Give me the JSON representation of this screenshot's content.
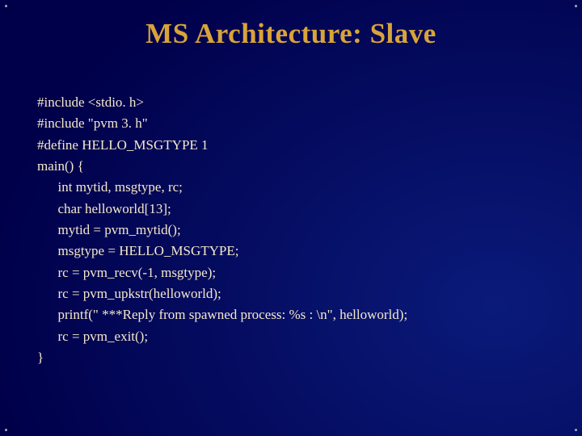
{
  "title": "MS Architecture: Slave",
  "code": {
    "l1": "#include <stdio. h>",
    "l2": "#include \"pvm 3. h\"",
    "l3": "#define HELLO_MSGTYPE 1",
    "l4": "main() {",
    "l5": "      int mytid, msgtype, rc;",
    "l6": "      char helloworld[13];",
    "l7": "      mytid = pvm_mytid();",
    "l8": "      msgtype = HELLO_MSGTYPE;",
    "l9": "      rc = pvm_recv(-1, msgtype);",
    "l10": "      rc = pvm_upkstr(helloworld);",
    "l11": "      printf(\" ***Reply from spawned process: %s : \\n\", helloworld);",
    "l12": "      rc = pvm_exit();",
    "l13": "}"
  }
}
